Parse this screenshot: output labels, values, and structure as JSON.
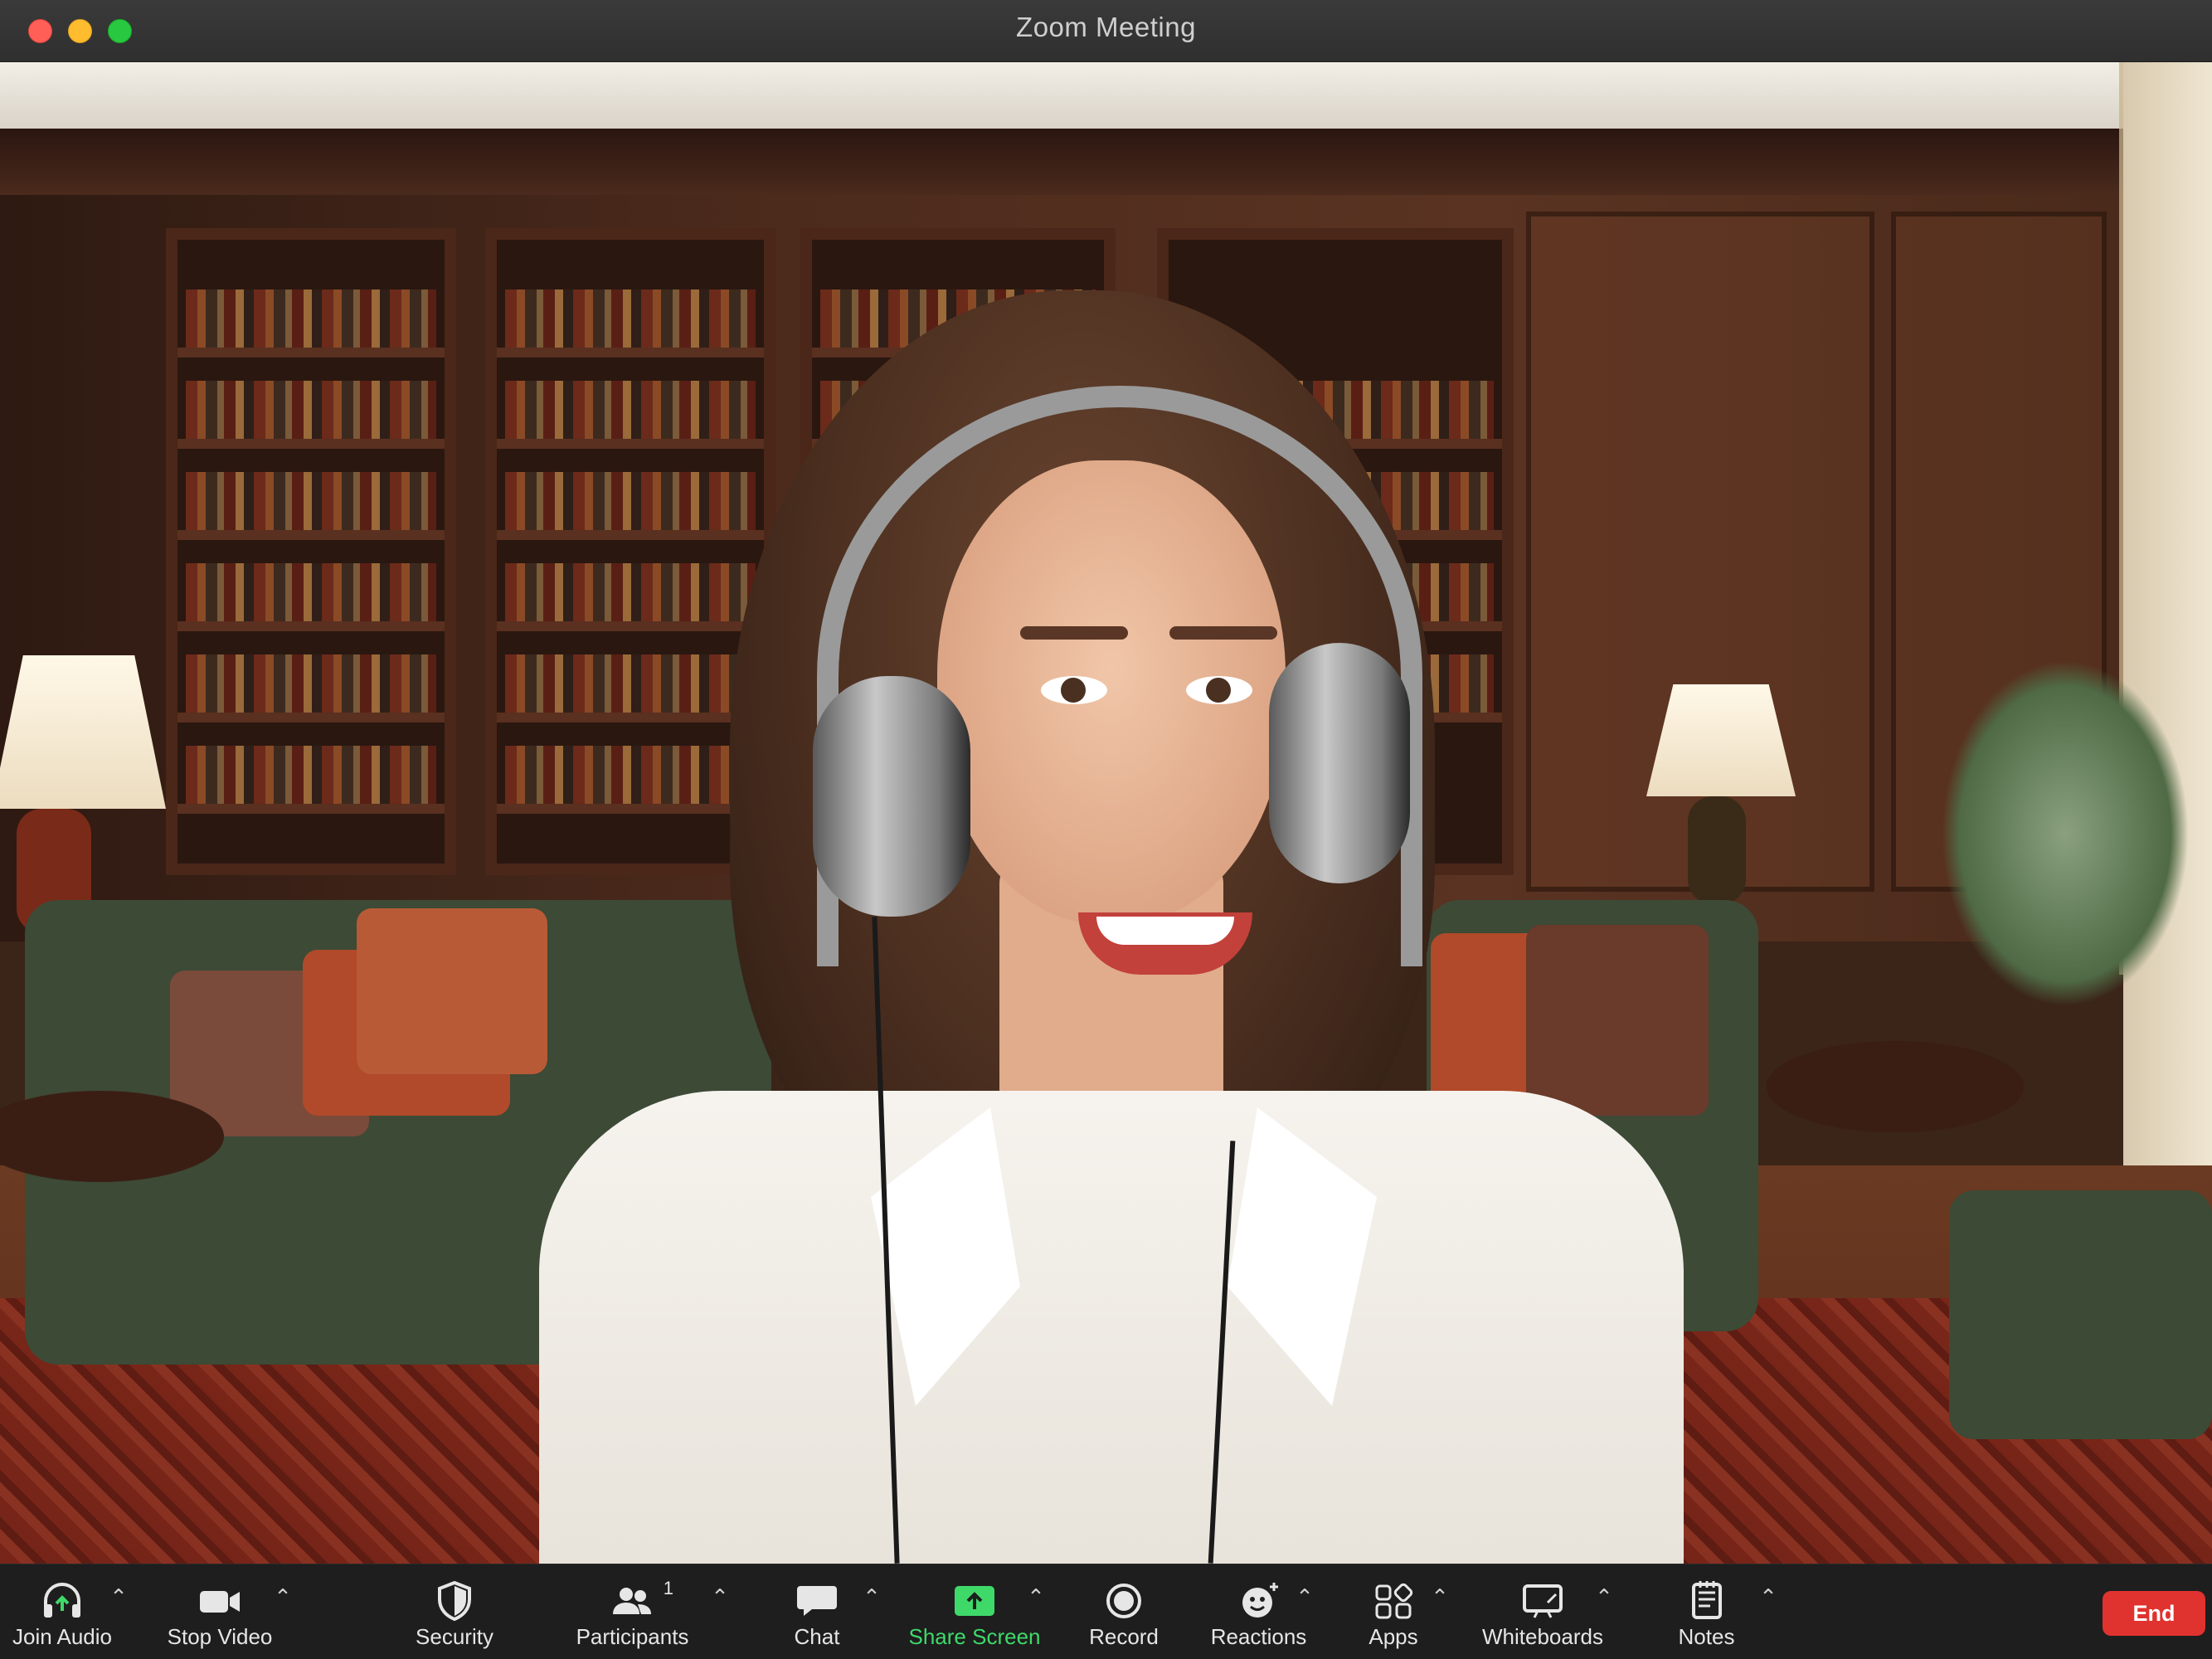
{
  "window": {
    "title": "Zoom Meeting",
    "traffic_lights": [
      "close",
      "minimize",
      "maximize"
    ]
  },
  "video": {
    "description_icon": "participant-video-feed",
    "virtual_background": "library-room"
  },
  "toolbar": {
    "items": [
      {
        "id": "join-audio",
        "label": "Join Audio",
        "icon": "headphone-join-icon",
        "has_caret": true
      },
      {
        "id": "stop-video",
        "label": "Stop Video",
        "icon": "video-camera-icon",
        "has_caret": true
      },
      {
        "id": "security",
        "label": "Security",
        "icon": "shield-icon",
        "has_caret": false
      },
      {
        "id": "participants",
        "label": "Participants",
        "icon": "people-icon",
        "count": "1",
        "has_caret": true
      },
      {
        "id": "chat",
        "label": "Chat",
        "icon": "chat-bubble-icon",
        "has_caret": true
      },
      {
        "id": "share-screen",
        "label": "Share Screen",
        "icon": "share-screen-icon",
        "has_caret": true
      },
      {
        "id": "record",
        "label": "Record",
        "icon": "record-icon",
        "has_caret": false
      },
      {
        "id": "reactions",
        "label": "Reactions",
        "icon": "smiley-plus-icon",
        "has_caret": true
      },
      {
        "id": "apps",
        "label": "Apps",
        "icon": "apps-icon",
        "has_caret": true
      },
      {
        "id": "whiteboards",
        "label": "Whiteboards",
        "icon": "whiteboard-icon",
        "has_caret": true
      },
      {
        "id": "notes",
        "label": "Notes",
        "icon": "notes-icon",
        "has_caret": true
      }
    ],
    "end_label": "End"
  },
  "colors": {
    "titlebar_bg": "#2f2f2f",
    "toolbar_bg": "#1e1e1e",
    "share_green": "#3fd96a",
    "end_red": "#e0322e",
    "traffic_close": "#ff5f57",
    "traffic_min": "#febc2e",
    "traffic_max": "#28c840"
  }
}
